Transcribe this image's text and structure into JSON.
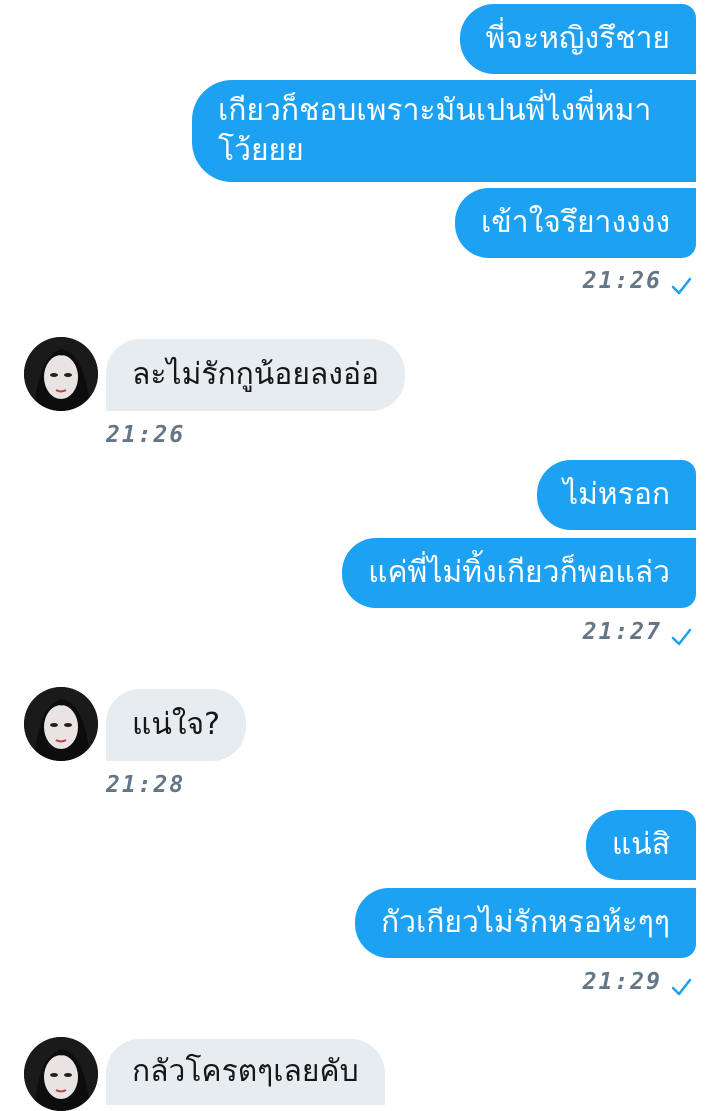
{
  "colors": {
    "outgoing_bubble": "#1da1f2",
    "incoming_bubble": "#e6ecf0",
    "timestamp": "#657786",
    "check": "#1da1f2"
  },
  "messages": [
    {
      "text": "พี่จะหญิงรึชาย"
    },
    {
      "text": "เกียวก็ชอบเพราะมันเปนพี่ไงพี่หมา โว้ยยย"
    },
    {
      "text": "เข้าใจรึยางงงง"
    },
    {
      "time": "21:26",
      "status_icon": "check-icon"
    },
    {
      "text": "ละไม่รักกูน้อยลงอ่อ",
      "time": "21:26"
    },
    {
      "text": "ไม่หรอก"
    },
    {
      "text": "แค่พี่ไม่ทิ้งเกียวก็พอแล่ว"
    },
    {
      "time": "21:27",
      "status_icon": "check-icon"
    },
    {
      "text": "แน่ใจ?",
      "time": "21:28"
    },
    {
      "text": "แน่สิ"
    },
    {
      "text": "กัวเกียวไม่รักหรอห้ะๆๆ"
    },
    {
      "time": "21:29",
      "status_icon": "check-icon"
    },
    {
      "text": "กลัวโครตๆเลยคับ"
    }
  ]
}
